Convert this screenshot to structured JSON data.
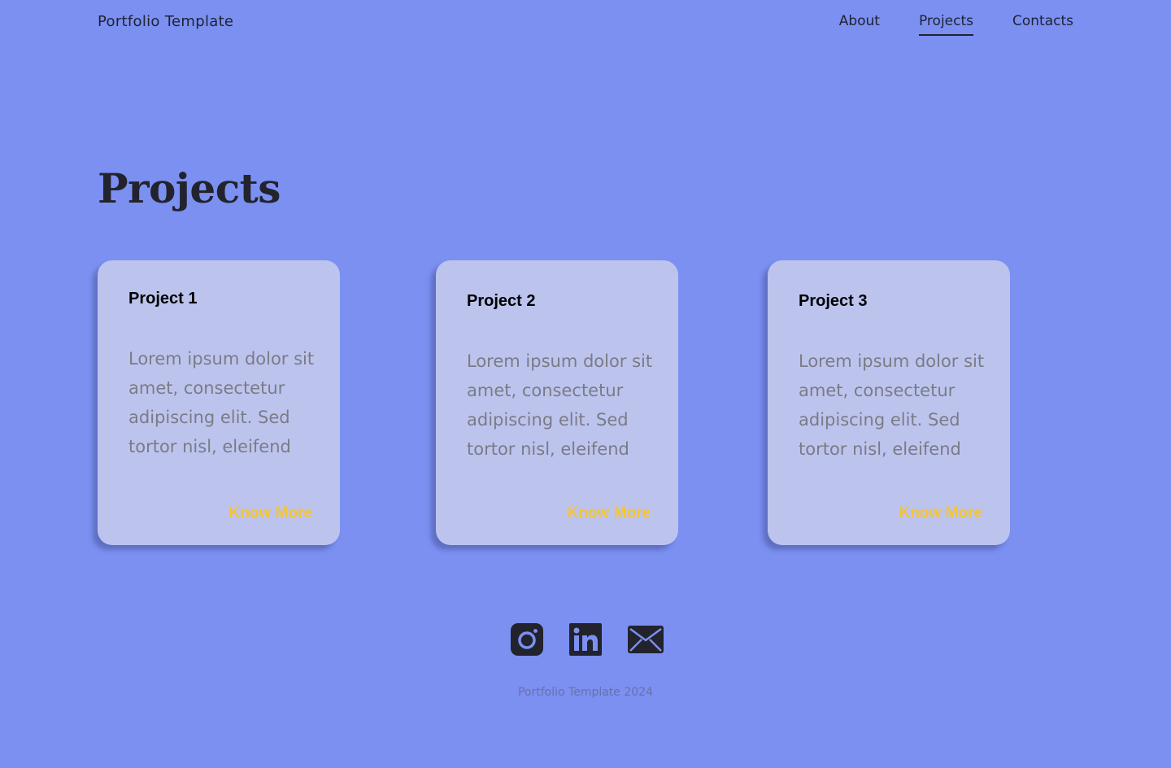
{
  "header": {
    "brand": "Portfolio Template",
    "nav": [
      {
        "label": "About",
        "active": false
      },
      {
        "label": "Projects",
        "active": true
      },
      {
        "label": "Contacts",
        "active": false
      }
    ]
  },
  "main": {
    "title": "Projects",
    "cards": [
      {
        "title": "Project 1",
        "description": "Lorem ipsum dolor sit amet, consectetur adipiscing elit. Sed tortor  nisl, eleifend",
        "link": "Know More"
      },
      {
        "title": "Project 2",
        "description": "Lorem ipsum dolor sit amet, consectetur adipiscing elit. Sed tortor  nisl, eleifend",
        "link": "Know More"
      },
      {
        "title": "Project 3",
        "description": "Lorem ipsum dolor sit amet, consectetur adipiscing elit. Sed tortor  nisl, eleifend",
        "link": "Know More"
      }
    ]
  },
  "social": {
    "icons": [
      "instagram-icon",
      "linkedin-icon",
      "email-icon"
    ]
  },
  "footer": {
    "text": "Portfolio Template 2024"
  },
  "colors": {
    "background": "#7b90f1",
    "card": "#bcc4ee",
    "accent": "#f4c437",
    "text_dark": "#22232d",
    "text_muted": "#7b7b86"
  }
}
